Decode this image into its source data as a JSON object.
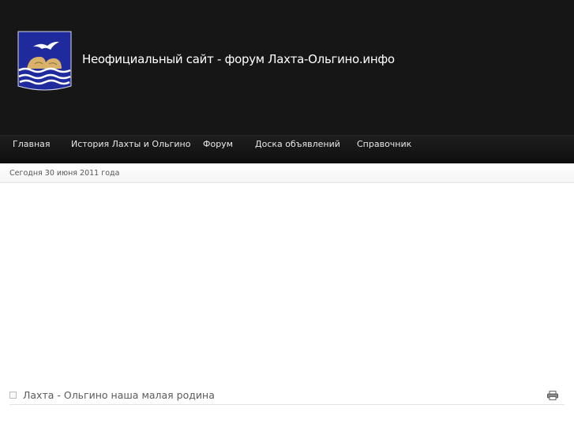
{
  "header": {
    "site_title": "Неофициальный сайт - форум Лахта-Ольгино.инфо",
    "logo_icon": "coat-of-arms-seagull-icon"
  },
  "nav": {
    "items": [
      {
        "label": "Главная"
      },
      {
        "label": "История Лахты и Ольгино"
      },
      {
        "label": "Форум"
      },
      {
        "label": "Доска объявлений"
      },
      {
        "label": "Справочник"
      }
    ]
  },
  "date_bar": {
    "text": "Сегодня 30 июня 2011 года"
  },
  "article": {
    "title": "Лахта - Ольгино наша малая родина",
    "print_icon": "print-icon"
  },
  "colors": {
    "header_bg": "#161616",
    "logo_blue": "#1f2a9c",
    "logo_gold": "#d9b26a"
  }
}
